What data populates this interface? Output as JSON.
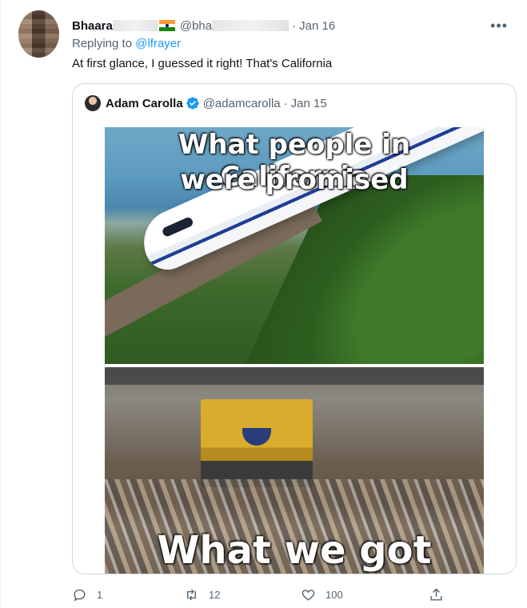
{
  "tweet": {
    "author_name": "Bhaara",
    "handle": "@bha",
    "date": "Jan 16",
    "replying_to_prefix": "Replying to",
    "replying_to_mention": "@lfrayer",
    "text": "At first glance, I guessed it right! That's California"
  },
  "quoted": {
    "name": "Adam Carolla",
    "handle": "@adamcarolla",
    "date": "Jan 15",
    "meme": {
      "top_caption_line1": "What people in California",
      "top_caption_line2": "were promised",
      "bottom_caption": "What we got"
    }
  },
  "actions": {
    "reply_count": "1",
    "retweet_count": "12",
    "like_count": "100"
  },
  "icons": [
    "more-icon",
    "verified-icon",
    "reply-icon",
    "retweet-icon",
    "like-icon",
    "share-icon",
    "india-flag-icon"
  ],
  "colors": {
    "accent": "#1d9bf0",
    "muted": "#536471",
    "text": "#0f1419"
  }
}
